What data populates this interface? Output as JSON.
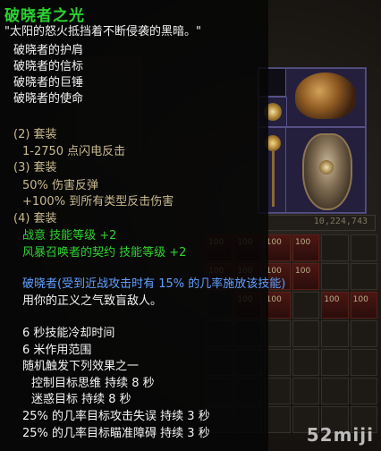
{
  "tooltip": {
    "title": "破晓者之光",
    "quote": "\"太阳的怒火抵挡着不断侵袭的黑暗。\"",
    "set_items": [
      "破晓者的护肩",
      "破晓者的信标",
      "破晓者的巨锤",
      "破晓者的使命"
    ],
    "bonus2_header": "(2) 套装",
    "bonus2_effect": "1-2750 点闪电反击",
    "bonus3_header": "(3) 套装",
    "bonus3_effects": [
      "50% 伤害反弹",
      "+100% 到所有类型反击伤害"
    ],
    "bonus4_header": "(4) 套装",
    "bonus4_skills": [
      "战意 技能等级 +2",
      "风暴召唤者的契约 技能等级 +2"
    ],
    "skill_proc": "破晓者(受到近战攻击时有 15% 的几率施放该技能)",
    "skill_desc": "用你的正义之气致盲敌人。",
    "cooldown": "6 秒技能冷却时间",
    "range": "6 米作用范围",
    "random_effect": "随机触发下列效果之一",
    "effects": [
      "控制目标思维 持续 8 秒",
      "迷惑目标 持续 8 秒",
      "25% 的几率目标攻击失误 持续 3 秒",
      "25% 的几率目标瞄准障碍 持续 3 秒"
    ]
  },
  "inventory": {
    "gold": "10,224,743",
    "stack_counts": [
      "100",
      "100",
      "100",
      "100",
      "100",
      "100",
      "100",
      "100",
      "100",
      "100",
      "100",
      "100"
    ]
  },
  "set_icons": [
    "shoulder-guard-icon",
    "amulet-beacon-icon",
    "mace-icon",
    "shield-icon"
  ],
  "watermark": "52miji",
  "colors": {
    "set_name": "#2bd332",
    "set_bonus_header": "#c8b98e",
    "skill_bonus": "#2fd22f",
    "skill_proc": "#5fa0ff",
    "text": "#f4f4f4"
  }
}
